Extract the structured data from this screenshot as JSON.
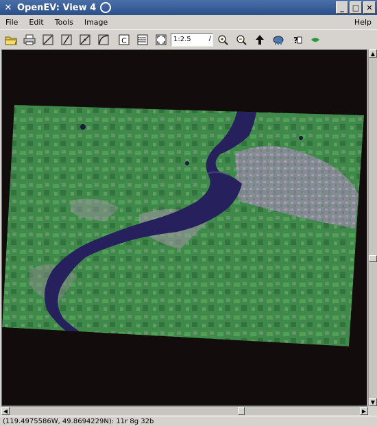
{
  "window": {
    "title": "OpenEV: View 4",
    "buttons": {
      "minimize": "_",
      "maximize": "□",
      "close": "✕"
    }
  },
  "menu": {
    "items": [
      {
        "label": "File"
      },
      {
        "label": "Edit"
      },
      {
        "label": "Tools"
      },
      {
        "label": "Image"
      }
    ],
    "help": "Help"
  },
  "toolbar": {
    "tools": [
      "open-folder-icon",
      "print-icon",
      "draw-line-icon",
      "edit-line-icon",
      "select-line-icon",
      "draw-curve-icon",
      "roi-icon",
      "copy-icon",
      "layers-icon",
      "fit-extent-icon"
    ],
    "zoom_value": "1:2.5",
    "right_tools": [
      "zoom-in-icon",
      "zoom-out-icon",
      "up-arrow-icon",
      "elephant-icon",
      "help-icon",
      "green-eye-icon"
    ]
  },
  "status": {
    "text": "(119.4975586W, 49.8694229N): 11r 8g 32b"
  },
  "colors": {
    "titlebar": "#3a5f98",
    "canvas_bg": "#120d0c",
    "land_green": "#3f8a4a",
    "lake": "#25205a",
    "urban": "#9a86a6"
  }
}
